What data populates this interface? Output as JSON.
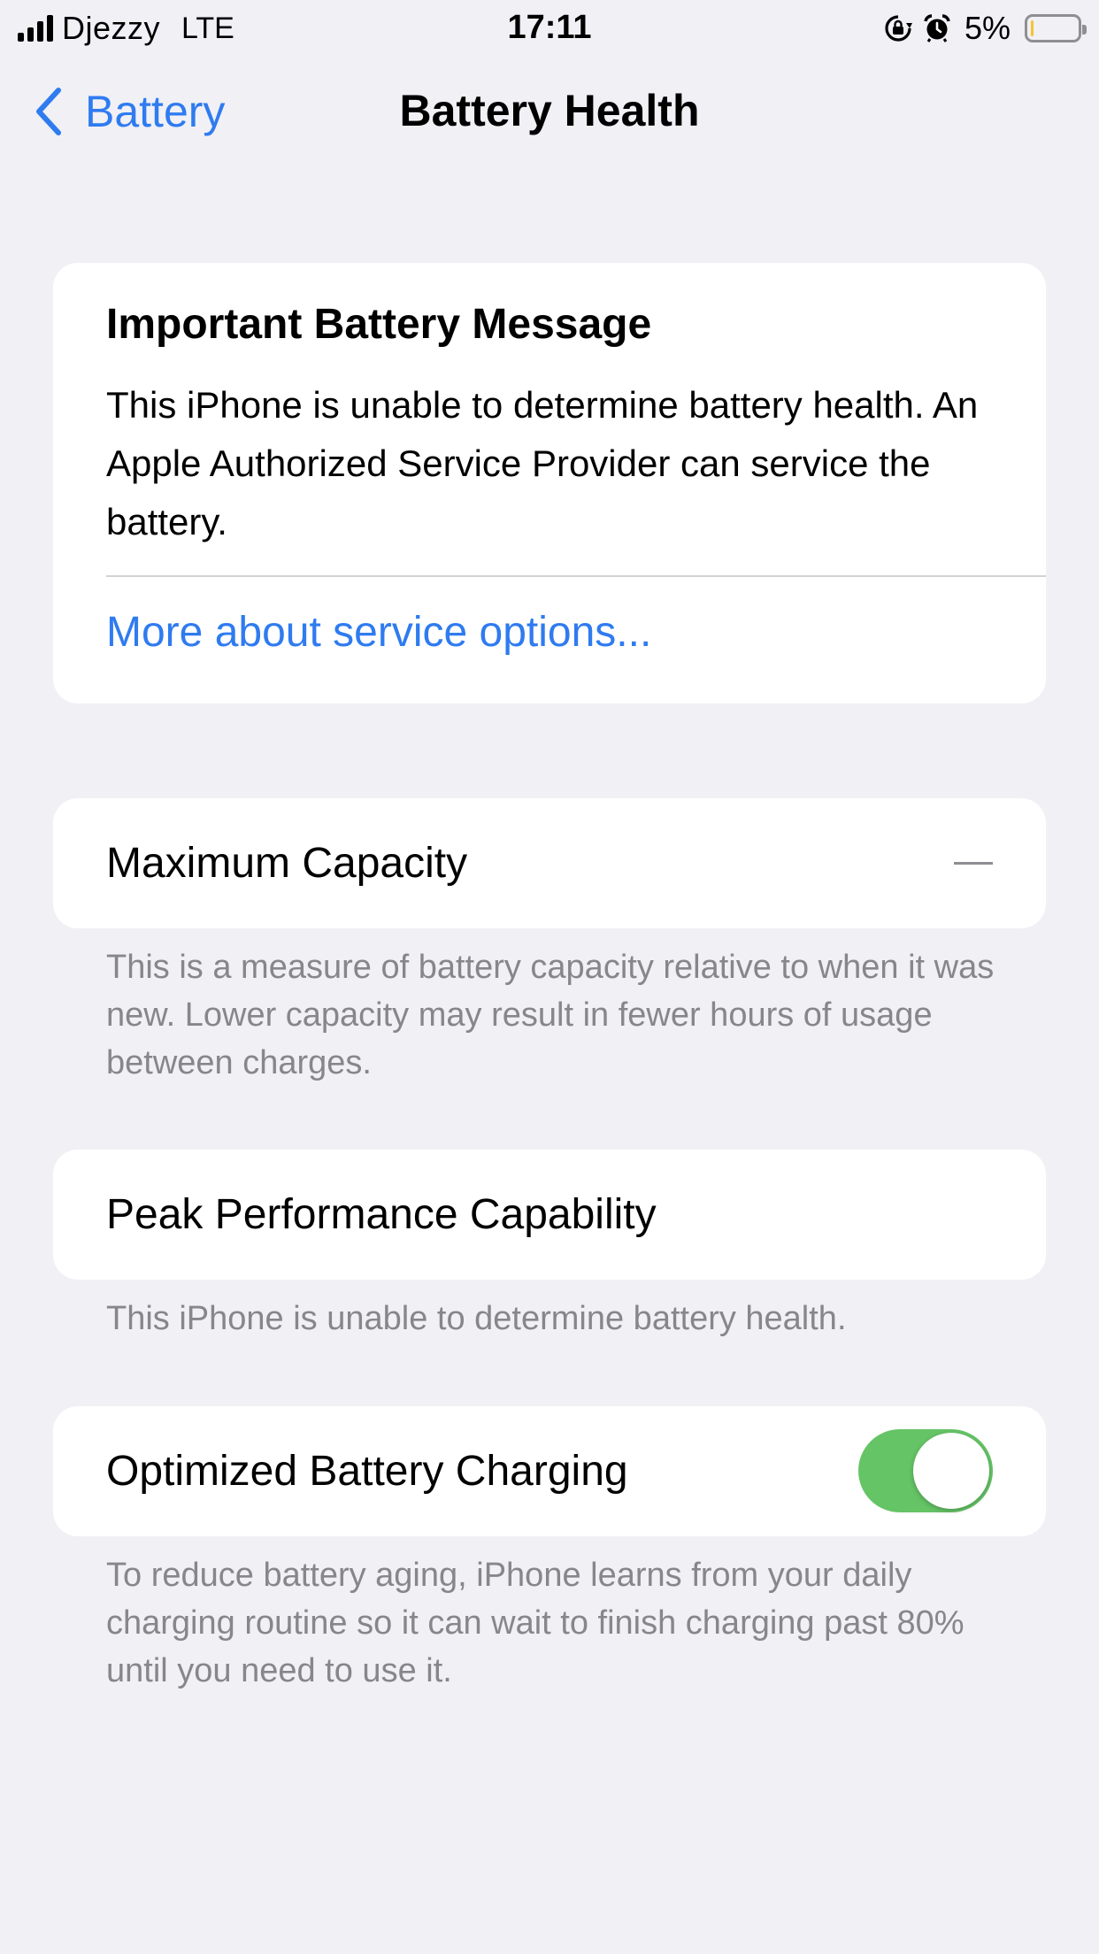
{
  "status_bar": {
    "carrier": "Djezzy",
    "network": "LTE",
    "time": "17:11",
    "battery_percent": "5%",
    "battery_level": 0.05,
    "battery_color": "#f5c431",
    "icons": [
      "signal-icon",
      "orientation-lock-icon",
      "alarm-icon",
      "battery-icon"
    ]
  },
  "nav": {
    "back_label": "Battery",
    "title": "Battery Health"
  },
  "message_card": {
    "title": "Important Battery Message",
    "body": "This iPhone is unable to determine battery health. An Apple Authorized Service Provider can service the battery.",
    "link": "More about service options..."
  },
  "maximum_capacity": {
    "label": "Maximum Capacity",
    "value": "—",
    "footnote": "This is a measure of battery capacity relative to when it was new. Lower capacity may result in fewer hours of usage between charges."
  },
  "peak_performance": {
    "label": "Peak Performance Capability",
    "footnote": "This iPhone is unable to determine battery health."
  },
  "optimized_charging": {
    "label": "Optimized Battery Charging",
    "enabled": true,
    "toggle_color": "#65c466",
    "footnote": "To reduce battery aging, iPhone learns from your daily charging routine so it can wait to finish charging past 80% until you need to use it."
  },
  "colors": {
    "accent": "#2f7bf0",
    "background": "#f0f0f5",
    "secondary_text": "#86868b"
  }
}
